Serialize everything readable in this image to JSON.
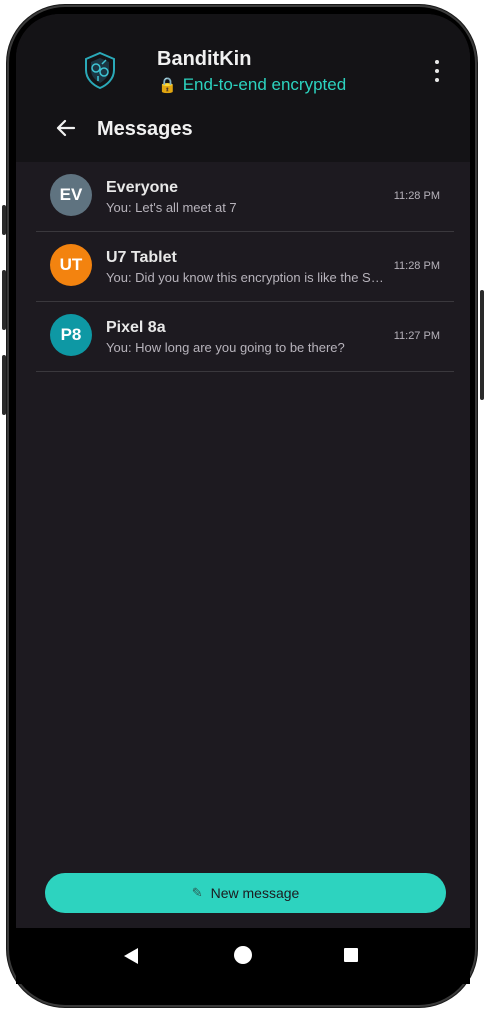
{
  "app": {
    "title": "BanditKin",
    "status": "End-to-end encrypted",
    "status_icon": "lock-icon",
    "menu_icon": "kebab-menu-icon",
    "logo_icon": "shield-logo-icon"
  },
  "page": {
    "title": "Messages",
    "back_icon": "arrow-back-icon"
  },
  "conversations": [
    {
      "initials": "EV",
      "name": "Everyone",
      "preview": "You: Let's all meet at 7",
      "time": "11:28 PM",
      "color": "#5f7380"
    },
    {
      "initials": "UT",
      "name": "U7 Tablet",
      "preview": "You: Did you know this encryption is like the Signal protocol",
      "time": "11:28 PM",
      "color": "#f3830f"
    },
    {
      "initials": "P8",
      "name": "Pixel 8a",
      "preview": "You: How long are you going to be there?",
      "time": "11:27 PM",
      "color": "#0e98a4"
    }
  ],
  "new_message": {
    "label": "New message",
    "icon": "pencil-icon"
  },
  "colors": {
    "accent": "#2dd3bf",
    "background": "#1d1a20",
    "header": "#141316"
  },
  "navbar": {
    "back": "nav-back-icon",
    "home": "nav-home-icon",
    "recents": "nav-recents-icon"
  }
}
